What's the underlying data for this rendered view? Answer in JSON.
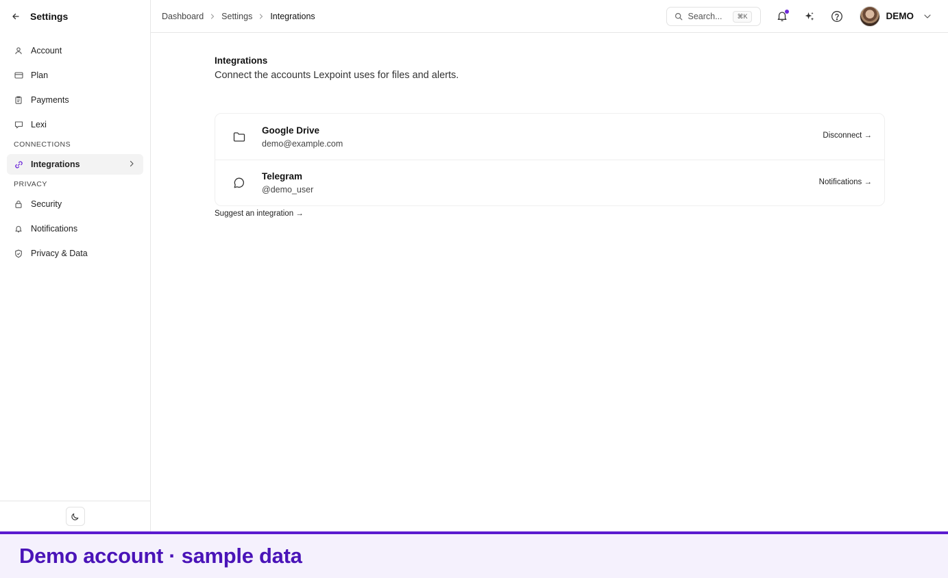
{
  "sidebar": {
    "title": "Settings",
    "items_top": [
      {
        "label": "Account",
        "icon": "user-icon"
      },
      {
        "label": "Plan",
        "icon": "card-icon"
      },
      {
        "label": "Payments",
        "icon": "clipboard-icon"
      },
      {
        "label": "Lexi",
        "icon": "chat-icon"
      }
    ],
    "section_connections": "CONNECTIONS",
    "item_integrations": {
      "label": "Integrations",
      "icon": "link-icon"
    },
    "section_privacy": "PRIVACY",
    "items_privacy": [
      {
        "label": "Security",
        "icon": "lock-icon"
      },
      {
        "label": "Notifications",
        "icon": "bell-icon"
      },
      {
        "label": "Privacy & Data",
        "icon": "shield-icon"
      }
    ]
  },
  "breadcrumb": [
    "Dashboard",
    "Settings",
    "Integrations"
  ],
  "search": {
    "placeholder": "Search...",
    "shortcut": "⌘K"
  },
  "user": {
    "name": "DEMO"
  },
  "main": {
    "title": "Integrations",
    "subtitle": "Connect the accounts Lexpoint uses for files and alerts.",
    "integrations": [
      {
        "name": "Google Drive",
        "account": "demo@example.com",
        "action": "Disconnect →",
        "icon": "folder-icon"
      },
      {
        "name": "Telegram",
        "account": "@demo_user",
        "action": "Notifications →",
        "icon": "message-icon"
      }
    ],
    "suggest": "Suggest an integration →"
  },
  "banner": {
    "text": "Demo account · sample data"
  },
  "colors": {
    "accent": "#6d28d9",
    "banner_text": "#4a14b8",
    "banner_bg": "#f5f1fd"
  }
}
